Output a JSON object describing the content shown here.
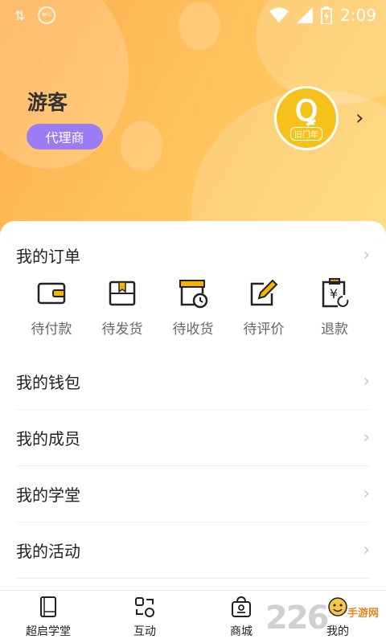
{
  "status_bar": {
    "time": "2:09",
    "icons": [
      "data-arrows-icon",
      "nfc-icon",
      "wifi-icon",
      "signal-icon",
      "battery-charging-icon"
    ],
    "nfc_text": "NFC"
  },
  "profile": {
    "username": "游客",
    "role": "代理商",
    "avatar_logo": "Ꝗ",
    "avatar_sub": "旧门年"
  },
  "orders": {
    "title": "我的订单",
    "items": [
      {
        "label": "待付款",
        "icon": "wallet-icon"
      },
      {
        "label": "待发货",
        "icon": "package-icon"
      },
      {
        "label": "待收货",
        "icon": "delivery-clock-icon"
      },
      {
        "label": "待评价",
        "icon": "edit-review-icon"
      },
      {
        "label": "退款",
        "icon": "refund-yen-icon"
      }
    ]
  },
  "menu": [
    {
      "label": "我的钱包"
    },
    {
      "label": "我的成员"
    },
    {
      "label": "我的学堂"
    },
    {
      "label": "我的活动"
    }
  ],
  "bottom_nav": [
    {
      "label": "超启学堂",
      "icon": "book-icon"
    },
    {
      "label": "互动",
      "icon": "interaction-icon"
    },
    {
      "label": "商城",
      "icon": "shop-bag-icon"
    },
    {
      "label": "我的",
      "icon": "profile-icon"
    }
  ],
  "watermark": {
    "number": "226",
    "text": "手游网"
  },
  "colors": {
    "header_start": "#ffad4f",
    "header_end": "#ffd36a",
    "badge": "#9b7cf3",
    "avatar_bg": "#f6c11b"
  }
}
